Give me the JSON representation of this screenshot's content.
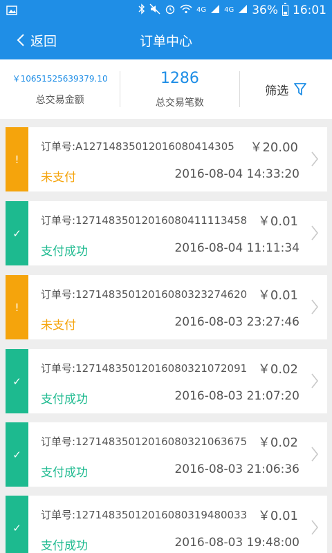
{
  "status_bar": {
    "network": "4G",
    "network2": "4G",
    "battery": "36%",
    "time": "16:01"
  },
  "nav": {
    "back_label": "返回",
    "title": "订单中心"
  },
  "summary": {
    "total_amount": "￥10651525639379.10",
    "total_amount_label": "总交易金额",
    "total_count": "1286",
    "total_count_label": "总交易笔数",
    "filter_label": "筛选"
  },
  "colors": {
    "primary": "#1f8ee6",
    "unpaid": "#f5a40c",
    "success": "#1dba8f"
  },
  "orders": [
    {
      "order_no": "订单号:A12714835012016080414305",
      "amount": "￥20.00",
      "status": "未支付",
      "time": "2016-08-04 14:33:20",
      "state": "unpaid",
      "icon": "!"
    },
    {
      "order_no": "订单号:12714835012016080411113458",
      "amount": "￥0.01",
      "status": "支付成功",
      "time": "2016-08-04 11:11:34",
      "state": "success",
      "icon": "✓"
    },
    {
      "order_no": "订单号:12714835012016080323274620",
      "amount": "￥0.01",
      "status": "未支付",
      "time": "2016-08-03 23:27:46",
      "state": "unpaid",
      "icon": "!"
    },
    {
      "order_no": "订单号:12714835012016080321072091",
      "amount": "￥0.02",
      "status": "支付成功",
      "time": "2016-08-03 21:07:20",
      "state": "success",
      "icon": "✓"
    },
    {
      "order_no": "订单号:12714835012016080321063675",
      "amount": "￥0.02",
      "status": "支付成功",
      "time": "2016-08-03 21:06:36",
      "state": "success",
      "icon": "✓"
    },
    {
      "order_no": "订单号:12714835012016080319480033",
      "amount": "￥0.01",
      "status": "支付成功",
      "time": "2016-08-03 19:48:00",
      "state": "success",
      "icon": "✓"
    }
  ]
}
